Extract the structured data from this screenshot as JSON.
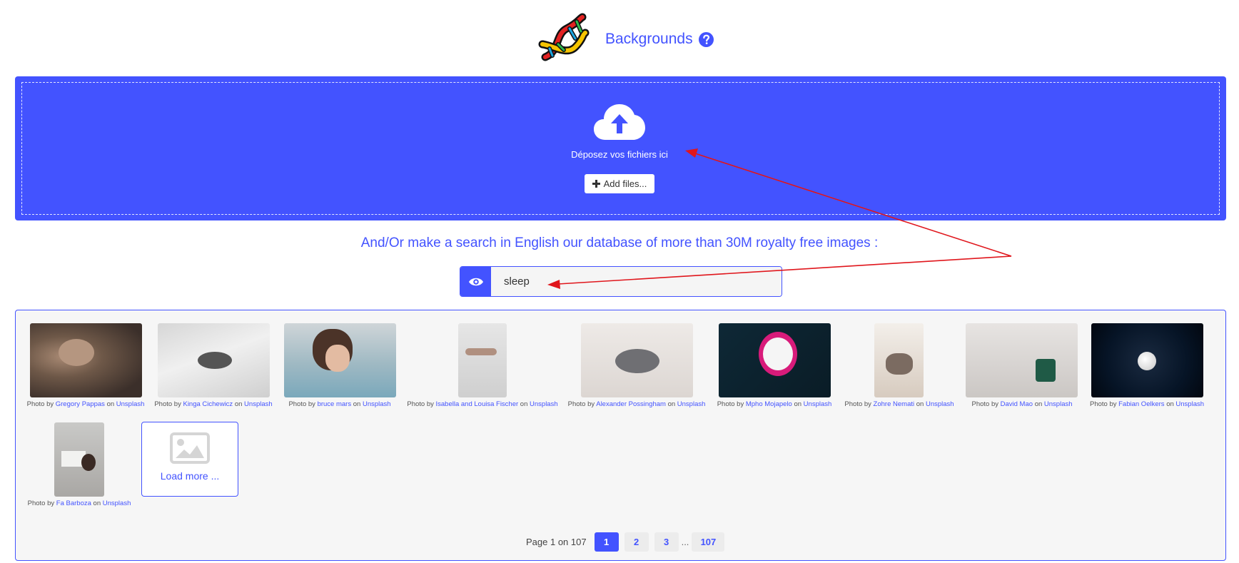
{
  "header": {
    "title": "Backgrounds",
    "logo": "dna-icon",
    "help_icon": "question-circle-icon"
  },
  "dropzone": {
    "text": "Déposez vos fichiers ici",
    "add_button": "Add files...",
    "icon": "cloud-upload-icon"
  },
  "search": {
    "title": "And/Or make a search in English our database of more than 30M royalty free images :",
    "value": "sleep",
    "icon": "eye-icon"
  },
  "results": [
    {
      "by": "Photo by",
      "author": "Gregory Pappas",
      "on": "on",
      "source": "Unsplash"
    },
    {
      "by": "Photo by",
      "author": "Kinga Cichewicz",
      "on": "on",
      "source": "Unsplash"
    },
    {
      "by": "Photo by",
      "author": "bruce mars",
      "on": "on",
      "source": "Unsplash"
    },
    {
      "by": "Photo by",
      "author": "Isabella and Louisa Fischer",
      "on": "on",
      "source": "Unsplash"
    },
    {
      "by": "Photo by",
      "author": "Alexander Possingham",
      "on": "on",
      "source": "Unsplash"
    },
    {
      "by": "Photo by",
      "author": "Mpho Mojapelo",
      "on": "on",
      "source": "Unsplash"
    },
    {
      "by": "Photo by",
      "author": "Zohre Nemati",
      "on": "on",
      "source": "Unsplash"
    },
    {
      "by": "Photo by",
      "author": "David Mao",
      "on": "on",
      "source": "Unsplash"
    },
    {
      "by": "Photo by",
      "author": "Fabian Oelkers",
      "on": "on",
      "source": "Unsplash"
    },
    {
      "by": "Photo by",
      "author": "Fa Barboza",
      "on": "on",
      "source": "Unsplash"
    }
  ],
  "load_more": "Load more ...",
  "pagination": {
    "label": "Page 1 on 107",
    "pages": [
      "1",
      "2",
      "3"
    ],
    "ellipsis": "...",
    "last": "107",
    "current": "1"
  },
  "colors": {
    "accent": "#4353ff",
    "annotation": "#e0161c"
  }
}
